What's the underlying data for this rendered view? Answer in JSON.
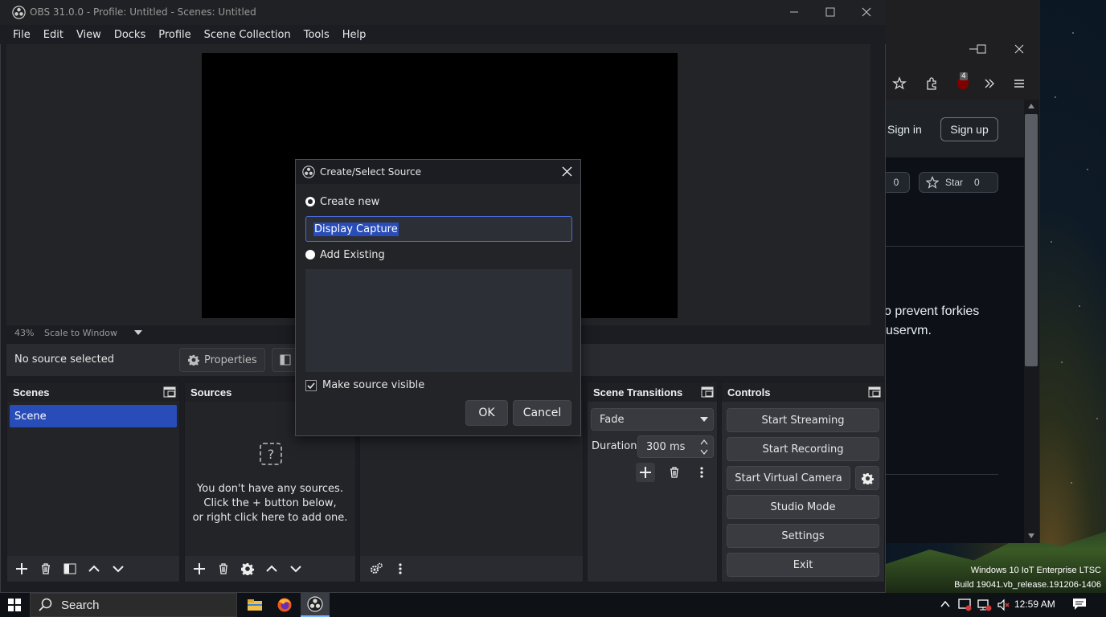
{
  "obs": {
    "title": "OBS 31.0.0 - Profile: Untitled - Scenes: Untitled",
    "menu": [
      "File",
      "Edit",
      "View",
      "Docks",
      "Profile",
      "Scene Collection",
      "Tools",
      "Help"
    ],
    "zoom_percent": "43%",
    "scale_mode": "Scale to Window",
    "no_source_text": "No source selected",
    "properties_label": "Properties",
    "scenes": {
      "title": "Scenes",
      "items": [
        "Scene"
      ]
    },
    "sources": {
      "title": "Sources",
      "empty_line1": "You don't have any sources.",
      "empty_line2": "Click the + button below,",
      "empty_line3": "or right click here to add one."
    },
    "transitions": {
      "title": "Scene Transitions",
      "selected": "Fade",
      "duration_label": "Duration",
      "duration_value": "300 ms"
    },
    "controls": {
      "title": "Controls",
      "start_streaming": "Start Streaming",
      "start_recording": "Start Recording",
      "start_virtual_camera": "Start Virtual Camera",
      "studio_mode": "Studio Mode",
      "settings": "Settings",
      "exit": "Exit"
    }
  },
  "dialog": {
    "title": "Create/Select Source",
    "create_new_label": "Create new",
    "name_value": "Display Capture",
    "add_existing_label": "Add Existing",
    "make_visible_label": "Make source visible",
    "make_visible_checked": true,
    "ok_label": "OK",
    "cancel_label": "Cancel"
  },
  "browser": {
    "sign_in": "Sign in",
    "sign_up": "Sign up",
    "notification_count": "4",
    "watch_count": "0",
    "star_label": "Star",
    "star_count": "0",
    "text_line1": "o prevent forkies",
    "text_line2": "uservm."
  },
  "desktop": {
    "os_line1": "Windows 10 IoT Enterprise LTSC",
    "os_line2": "Build 19041.vb_release.191206-1406"
  },
  "taskbar": {
    "search_label": "Search",
    "clock": "12:59 AM"
  },
  "colors": {
    "accent": "#284cb8",
    "panel": "#2a2b30",
    "background": "#1c1d22"
  }
}
